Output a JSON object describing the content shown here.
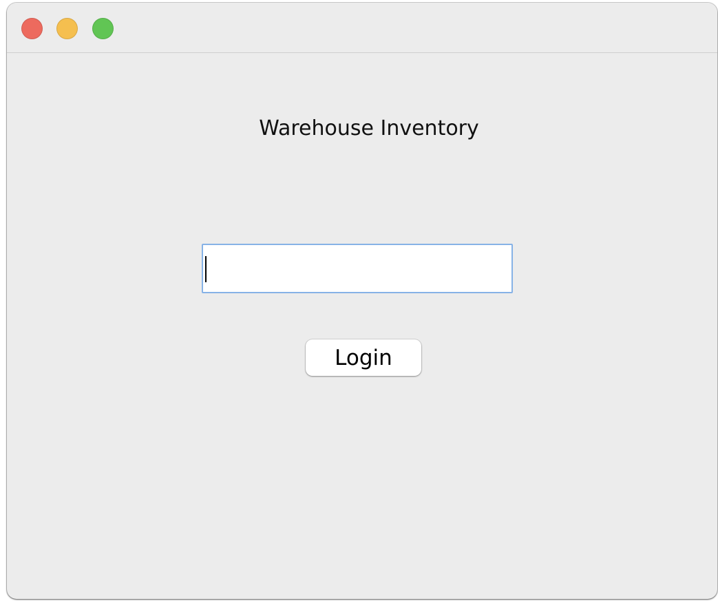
{
  "window": {
    "controls": {
      "close": {
        "icon": "close-traffic-light",
        "color": "#ed6a5e"
      },
      "minimize": {
        "icon": "minimize-traffic-light",
        "color": "#f5bf4f"
      },
      "zoom": {
        "icon": "zoom-traffic-light",
        "color": "#61c554"
      }
    }
  },
  "app": {
    "title": "Warehouse Inventory"
  },
  "login": {
    "input_value": "",
    "input_placeholder": "",
    "button_label": "Login"
  },
  "colors": {
    "window_background": "#ececec",
    "focus_ring": "#86b2e6"
  }
}
